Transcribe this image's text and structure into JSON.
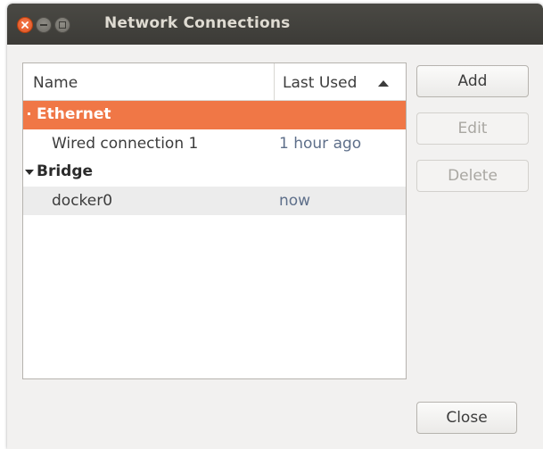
{
  "window": {
    "title": "Network Connections"
  },
  "list": {
    "columns": {
      "name": "Name",
      "last_used": "Last Used"
    },
    "groups": [
      {
        "label": "Ethernet",
        "selected": true,
        "connections": [
          {
            "name": "Wired connection 1",
            "last_used": "1 hour ago"
          }
        ]
      },
      {
        "label": "Bridge",
        "selected": false,
        "connections": [
          {
            "name": "docker0",
            "last_used": "now"
          }
        ]
      }
    ]
  },
  "buttons": {
    "add": "Add",
    "edit": "Edit",
    "delete": "Delete",
    "close": "Close"
  },
  "colors": {
    "selection": "#f07746",
    "titlebar": "#3c3b37",
    "close_button": "#e0521f",
    "last_used_text": "#5e6f8a"
  },
  "icons": {
    "close": "close-icon",
    "minimize": "minimize-icon",
    "maximize": "maximize-icon",
    "sort": "sort-ascending-icon",
    "expander": "expander-arrow-icon"
  }
}
